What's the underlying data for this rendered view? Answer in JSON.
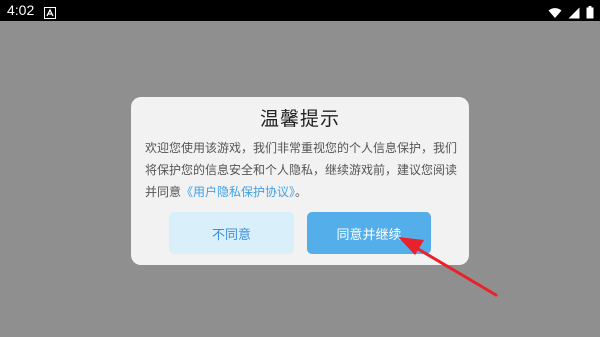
{
  "status_bar": {
    "time": "4:02",
    "notification_icon": "android-notification-icon",
    "wifi_icon": "wifi-icon",
    "signal_icon": "signal-icon",
    "battery_icon": "battery-icon"
  },
  "dialog": {
    "title": "温馨提示",
    "body_text": "欢迎您使用该游戏，我们非常重视您的个人信息保护，我们将保护您的信息安全和个人隐私，继续游戏前，建议您阅读并同意",
    "agreement_link": "《用户隐私保护协议》",
    "body_end": "。",
    "disagree_label": "不同意",
    "agree_label": "同意并继续"
  },
  "colors": {
    "overlay": "#8f8f8f",
    "dialog_bg": "#f2f2f2",
    "link": "#3fa0e6",
    "agree_button": "#53aeea",
    "disagree_button": "#d9f0fb",
    "annotation_arrow": "#e8212b"
  },
  "annotation": {
    "icon": "red-arrow-annotation"
  }
}
